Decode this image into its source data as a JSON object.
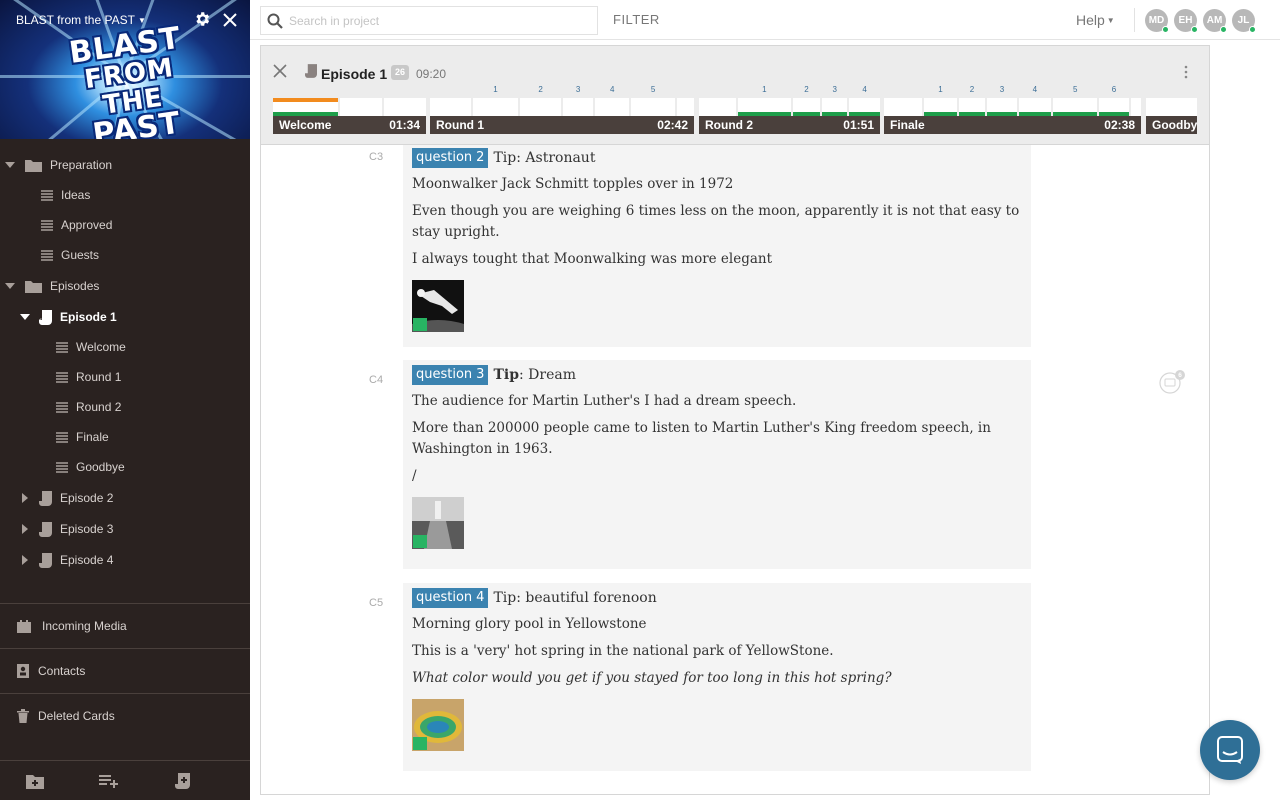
{
  "sidebar": {
    "project_title": "BLAST from the PAST",
    "banner_logo": [
      "BLAST",
      "FROM THE",
      "PAST"
    ],
    "tree": [
      {
        "label": "Preparation",
        "type": "folder"
      },
      {
        "label": "Ideas",
        "type": "list"
      },
      {
        "label": "Approved",
        "type": "list"
      },
      {
        "label": "Guests",
        "type": "list"
      },
      {
        "label": "Episodes",
        "type": "folder"
      },
      {
        "label": "Episode 1",
        "type": "episode",
        "selected": true
      },
      {
        "label": "Welcome",
        "type": "list"
      },
      {
        "label": "Round 1",
        "type": "list"
      },
      {
        "label": "Round 2",
        "type": "list"
      },
      {
        "label": "Finale",
        "type": "list"
      },
      {
        "label": "Goodbye",
        "type": "list"
      },
      {
        "label": "Episode 2",
        "type": "episode"
      },
      {
        "label": "Episode 3",
        "type": "episode"
      },
      {
        "label": "Episode 4",
        "type": "episode"
      }
    ],
    "sections": [
      "Incoming Media",
      "Contacts",
      "Deleted Cards"
    ]
  },
  "topbar": {
    "search_placeholder": "Search in project",
    "filter_label": "FILTER",
    "help_label": "Help",
    "avatars": [
      "MD",
      "EH",
      "AM",
      "JL"
    ]
  },
  "episode": {
    "title": "Episode 1",
    "count": "26",
    "duration": "09:20",
    "segments": [
      {
        "name": "Welcome",
        "time": "01:34",
        "numbers": [
          "",
          "",
          ""
        ]
      },
      {
        "name": "Round 1",
        "time": "02:42",
        "numbers": [
          "",
          "1",
          "2",
          "3",
          "4",
          "5",
          ""
        ]
      },
      {
        "name": "Round 2",
        "time": "01:51",
        "numbers": [
          "",
          "1",
          "2",
          "3",
          "4"
        ]
      },
      {
        "name": "Finale",
        "time": "02:38",
        "numbers": [
          "",
          "1",
          "2",
          "3",
          "4",
          "5",
          "6",
          ""
        ]
      },
      {
        "name": "Goodby",
        "time": "",
        "numbers": [
          ""
        ]
      }
    ]
  },
  "cards": [
    {
      "code": "C3",
      "question_word": "question",
      "question_number": "2",
      "tip_label": "Tip",
      "tip_value": "Astronaut",
      "lines": [
        "Moonwalker Jack Schmitt topples over in 1972",
        "Even though you are weighing 6 times less on the moon, apparently it is not that easy to stay upright.",
        "I always tought that Moonwalking was more elegant"
      ]
    },
    {
      "code": "C4",
      "question_word": "question",
      "question_number": "3",
      "tip_label": "Tip",
      "tip_value": "Dream",
      "lines": [
        "The audience for Martin Luther's I had a dream speech.",
        "More than 200000 people came to listen to Martin Luther's King freedom speech, in Washington  in 1963.",
        "/"
      ]
    },
    {
      "code": "C5",
      "question_word": "question",
      "question_number": "4",
      "tip_label": "Tip",
      "tip_value": "beautiful forenoon",
      "lines": [
        "Morning glory pool in Yellowstone",
        "This is a 'very' hot spring in the national park of YellowStone.",
        "What color would you get if you stayed for too long in this hot spring?"
      ]
    }
  ],
  "comments": {
    "count": "6"
  },
  "colors": {
    "accent": "#3b83b0",
    "sidebar_bg": "#2a2220",
    "progress_green": "#1e9e4a",
    "progress_orange": "#f28b1e",
    "online": "#28b463"
  }
}
